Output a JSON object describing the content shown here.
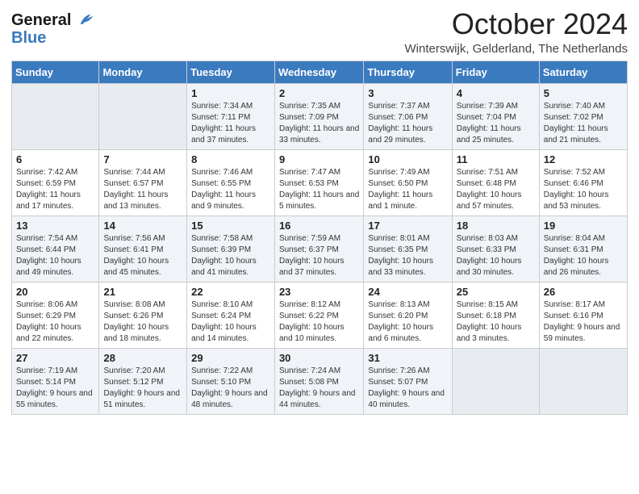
{
  "header": {
    "logo_line1": "General",
    "logo_line2": "Blue",
    "month_title": "October 2024",
    "subtitle": "Winterswijk, Gelderland, The Netherlands"
  },
  "days_of_week": [
    "Sunday",
    "Monday",
    "Tuesday",
    "Wednesday",
    "Thursday",
    "Friday",
    "Saturday"
  ],
  "weeks": [
    [
      {
        "day": "",
        "info": ""
      },
      {
        "day": "",
        "info": ""
      },
      {
        "day": "1",
        "info": "Sunrise: 7:34 AM\nSunset: 7:11 PM\nDaylight: 11 hours and 37 minutes."
      },
      {
        "day": "2",
        "info": "Sunrise: 7:35 AM\nSunset: 7:09 PM\nDaylight: 11 hours and 33 minutes."
      },
      {
        "day": "3",
        "info": "Sunrise: 7:37 AM\nSunset: 7:06 PM\nDaylight: 11 hours and 29 minutes."
      },
      {
        "day": "4",
        "info": "Sunrise: 7:39 AM\nSunset: 7:04 PM\nDaylight: 11 hours and 25 minutes."
      },
      {
        "day": "5",
        "info": "Sunrise: 7:40 AM\nSunset: 7:02 PM\nDaylight: 11 hours and 21 minutes."
      }
    ],
    [
      {
        "day": "6",
        "info": "Sunrise: 7:42 AM\nSunset: 6:59 PM\nDaylight: 11 hours and 17 minutes."
      },
      {
        "day": "7",
        "info": "Sunrise: 7:44 AM\nSunset: 6:57 PM\nDaylight: 11 hours and 13 minutes."
      },
      {
        "day": "8",
        "info": "Sunrise: 7:46 AM\nSunset: 6:55 PM\nDaylight: 11 hours and 9 minutes."
      },
      {
        "day": "9",
        "info": "Sunrise: 7:47 AM\nSunset: 6:53 PM\nDaylight: 11 hours and 5 minutes."
      },
      {
        "day": "10",
        "info": "Sunrise: 7:49 AM\nSunset: 6:50 PM\nDaylight: 11 hours and 1 minute."
      },
      {
        "day": "11",
        "info": "Sunrise: 7:51 AM\nSunset: 6:48 PM\nDaylight: 10 hours and 57 minutes."
      },
      {
        "day": "12",
        "info": "Sunrise: 7:52 AM\nSunset: 6:46 PM\nDaylight: 10 hours and 53 minutes."
      }
    ],
    [
      {
        "day": "13",
        "info": "Sunrise: 7:54 AM\nSunset: 6:44 PM\nDaylight: 10 hours and 49 minutes."
      },
      {
        "day": "14",
        "info": "Sunrise: 7:56 AM\nSunset: 6:41 PM\nDaylight: 10 hours and 45 minutes."
      },
      {
        "day": "15",
        "info": "Sunrise: 7:58 AM\nSunset: 6:39 PM\nDaylight: 10 hours and 41 minutes."
      },
      {
        "day": "16",
        "info": "Sunrise: 7:59 AM\nSunset: 6:37 PM\nDaylight: 10 hours and 37 minutes."
      },
      {
        "day": "17",
        "info": "Sunrise: 8:01 AM\nSunset: 6:35 PM\nDaylight: 10 hours and 33 minutes."
      },
      {
        "day": "18",
        "info": "Sunrise: 8:03 AM\nSunset: 6:33 PM\nDaylight: 10 hours and 30 minutes."
      },
      {
        "day": "19",
        "info": "Sunrise: 8:04 AM\nSunset: 6:31 PM\nDaylight: 10 hours and 26 minutes."
      }
    ],
    [
      {
        "day": "20",
        "info": "Sunrise: 8:06 AM\nSunset: 6:29 PM\nDaylight: 10 hours and 22 minutes."
      },
      {
        "day": "21",
        "info": "Sunrise: 8:08 AM\nSunset: 6:26 PM\nDaylight: 10 hours and 18 minutes."
      },
      {
        "day": "22",
        "info": "Sunrise: 8:10 AM\nSunset: 6:24 PM\nDaylight: 10 hours and 14 minutes."
      },
      {
        "day": "23",
        "info": "Sunrise: 8:12 AM\nSunset: 6:22 PM\nDaylight: 10 hours and 10 minutes."
      },
      {
        "day": "24",
        "info": "Sunrise: 8:13 AM\nSunset: 6:20 PM\nDaylight: 10 hours and 6 minutes."
      },
      {
        "day": "25",
        "info": "Sunrise: 8:15 AM\nSunset: 6:18 PM\nDaylight: 10 hours and 3 minutes."
      },
      {
        "day": "26",
        "info": "Sunrise: 8:17 AM\nSunset: 6:16 PM\nDaylight: 9 hours and 59 minutes."
      }
    ],
    [
      {
        "day": "27",
        "info": "Sunrise: 7:19 AM\nSunset: 5:14 PM\nDaylight: 9 hours and 55 minutes."
      },
      {
        "day": "28",
        "info": "Sunrise: 7:20 AM\nSunset: 5:12 PM\nDaylight: 9 hours and 51 minutes."
      },
      {
        "day": "29",
        "info": "Sunrise: 7:22 AM\nSunset: 5:10 PM\nDaylight: 9 hours and 48 minutes."
      },
      {
        "day": "30",
        "info": "Sunrise: 7:24 AM\nSunset: 5:08 PM\nDaylight: 9 hours and 44 minutes."
      },
      {
        "day": "31",
        "info": "Sunrise: 7:26 AM\nSunset: 5:07 PM\nDaylight: 9 hours and 40 minutes."
      },
      {
        "day": "",
        "info": ""
      },
      {
        "day": "",
        "info": ""
      }
    ]
  ]
}
